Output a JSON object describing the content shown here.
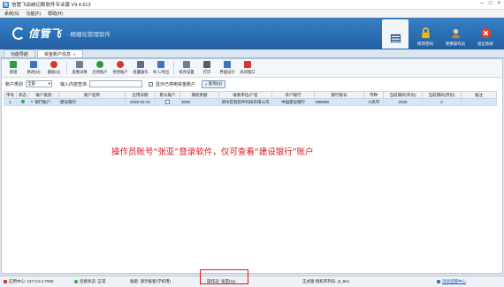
{
  "window": {
    "title": "信管飞出纳记账软件专业版 V9.4.613",
    "app_icon_glyph": "信"
  },
  "menu": [
    "系统(S)",
    "功能(F)",
    "帮助(H)"
  ],
  "banner": {
    "brand_name": "信管飞",
    "slogan": "- 精细化管理软件",
    "tools": [
      {
        "label": "",
        "icon": "grid-icon"
      },
      {
        "label": "修改密码",
        "icon": "lock-icon"
      },
      {
        "label": "更换操作员",
        "icon": "user-icon"
      },
      {
        "label": "退出系统",
        "icon": "exit-icon"
      }
    ]
  },
  "tabs": [
    {
      "label": "功能导航"
    },
    {
      "label": "资金账户信息",
      "close": "×"
    }
  ],
  "toolbar": [
    {
      "label": "新增",
      "icon": "add-icon",
      "color": "#2f9a3a"
    },
    {
      "label": "修改(M)",
      "icon": "edit-icon",
      "color": "#3b73c9"
    },
    {
      "label": "删除(D)",
      "icon": "delete-icon",
      "color": "#d23a2e"
    },
    {
      "label": "查看详情",
      "icon": "detail-icon",
      "color": "#6a7f99"
    },
    {
      "label": "启用账户",
      "icon": "enable-icon",
      "color": "#2f9a3a"
    },
    {
      "label": "停用账户",
      "icon": "disable-icon",
      "color": "#d23a2e"
    },
    {
      "label": "批量操作",
      "icon": "batch-icon",
      "color": "#5a6f8a"
    },
    {
      "label": "导入/导出",
      "icon": "import-export-icon",
      "color": "#3b73c9"
    },
    {
      "label": "排序设置",
      "icon": "sort-icon",
      "color": "#6a7f99"
    },
    {
      "label": "打印",
      "icon": "print-icon",
      "color": "#4f5f74"
    },
    {
      "label": "界面设计",
      "icon": "design-icon",
      "color": "#3b73c9"
    },
    {
      "label": "关闭窗口",
      "icon": "close-window-icon",
      "color": "#d23a2e"
    }
  ],
  "filter": {
    "account_type_label": "账户类别",
    "account_type_value": "全部",
    "query_label": "输入内容查询",
    "query_value": "",
    "show_disabled_label": "显示已停用资金账户",
    "show_disabled_checked": "✓",
    "query_button": "查询(Q)"
  },
  "table": {
    "columns": [
      "序号",
      "状态",
      "账户类别",
      "账户名称",
      "启用日期",
      "默认账户",
      "期初余额",
      "收款单位/户名",
      "开户银行",
      "银行账号",
      "币种",
      "当前期间(年份)",
      "当前期间(月份)",
      "备注"
    ],
    "rows": [
      [
        "1",
        "",
        "银行账户",
        "建设银行",
        "2025-02-21",
        "",
        "3000",
        "郑州匠程软件科技有限公司",
        "中国建设银行",
        "888888",
        "人民币",
        "2025",
        "2",
        ""
      ]
    ]
  },
  "annotation": "操作员账号“张亚”登录软件，仅可查看“建设银行”账户",
  "statusbar": {
    "app_center": "应用中心: 127.0.0.1:7082",
    "connection": "连接状态: 正常",
    "book": "账套: 演示账套(学校用)",
    "operator": "操作员: 张亚(zy)",
    "license": "正式版   授权序列号: yt_8ex",
    "message_center": "消息提醒中心"
  },
  "colors": {
    "banner": "#2a6eb3",
    "status_ok": "#2fa84f",
    "annotation": "#e0161a"
  }
}
